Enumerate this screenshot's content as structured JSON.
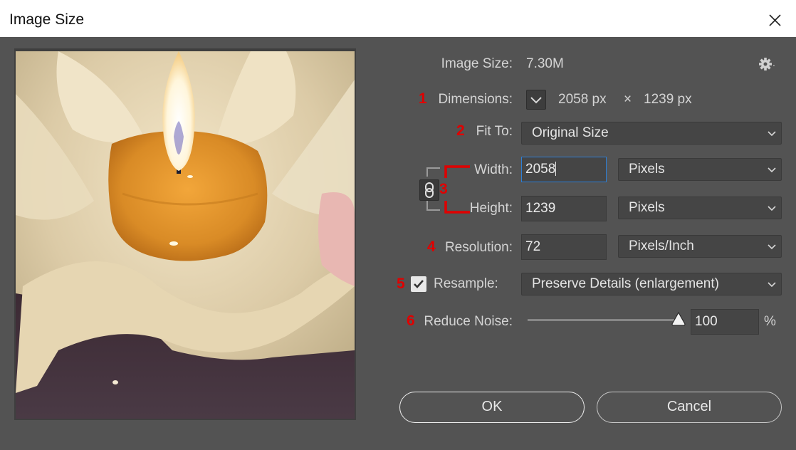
{
  "window": {
    "title": "Image Size",
    "close_icon": "close-icon"
  },
  "info": {
    "image_size_label": "Image Size:",
    "image_size_value": "7.30M",
    "settings_icon": "gear-icon",
    "settings_menu_glyph": ".",
    "dimensions_label": "Dimensions:",
    "dimensions_width": "2058 px",
    "dimensions_times": "×",
    "dimensions_height": "1239 px"
  },
  "fit_to": {
    "label": "Fit To:",
    "value": "Original Size"
  },
  "width": {
    "label": "Width:",
    "value": "2058",
    "unit": "Pixels"
  },
  "height": {
    "label": "Height:",
    "value": "1239",
    "unit": "Pixels"
  },
  "resolution": {
    "label": "Resolution:",
    "value": "72",
    "unit": "Pixels/Inch"
  },
  "resample": {
    "label": "Resample:",
    "checked": true,
    "method": "Preserve Details (enlargement)"
  },
  "reduce_noise": {
    "label": "Reduce Noise:",
    "value": "100",
    "unit": "%",
    "slider_level": 1.0
  },
  "buttons": {
    "ok": "OK",
    "cancel": "Cancel"
  },
  "markers": [
    "1",
    "2",
    "3",
    "4",
    "5",
    "6"
  ],
  "colors": {
    "marker_red": "#e00000",
    "focus_blue": "#2d7fd6",
    "panel_bg": "#535353"
  }
}
